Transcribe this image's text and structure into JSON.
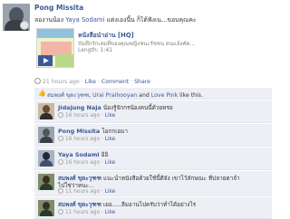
{
  "post": {
    "author": "Pong Missita",
    "text_before_tag": "ลองานน้อง ",
    "tagged": "Yaya Sodami",
    "text_after_tag": " แต่งเองนี้น ก็ได้ฟังเน...ขอบคุณคะ",
    "video": {
      "title": "หนังสือนำอ่าน [HQ]",
      "description": "บันทึกรักเล่มที่ของคุณหญิงชนะรัชชน คนแล้งคัด...",
      "length": "Length: 1:41"
    },
    "meta": {
      "time": "21 hours ago",
      "like": "Like",
      "comment": "Comment",
      "share": "Share"
    },
    "likes": {
      "names_1": "สมพงศ์ ขุดะวุฑฑ",
      "sep_1": ", ",
      "names_2": "Urai Praihooyan",
      "and": " and ",
      "names_3": "Love Pink",
      "suffix": " like this."
    }
  },
  "comments": [
    {
      "name": "Jidajung Naja",
      "text": "น้องรู้จักกรน้องคนนี้ด้วยหรอ",
      "text2": "",
      "time": "16 hours ago",
      "like": "Like"
    },
    {
      "name": "Pong Missita",
      "text": "โอกกเอมา",
      "text2": "",
      "time": "16 hours ago",
      "like": "Like"
    },
    {
      "name": "Yaya Sodami",
      "text": "อิอิ",
      "text2": "",
      "time": "16 hours ago",
      "like": "Like"
    },
    {
      "name": "สมพงศ์ ขุดะวุฑฑ",
      "text": "แนะนำหนังสือด้วยใช้นี้ดีจัง เขาไว้ลักษณะ ที่ปลายตาจำ",
      "text2": "ไปใช่ว่าหนะ...",
      "time": "11 hours ago",
      "like": "Like"
    },
    {
      "name": "สมพงศ์ ขุดะวุฑฑ",
      "text": "เยอ.....ลืมอานไปครับว่าทำได้อย่างไร",
      "text2": "",
      "time": "11 hours ago",
      "like": "Like"
    }
  ],
  "colors": {
    "link": "#3b5998",
    "comment_bg": "#edeff4",
    "meta_gray": "#999999"
  }
}
